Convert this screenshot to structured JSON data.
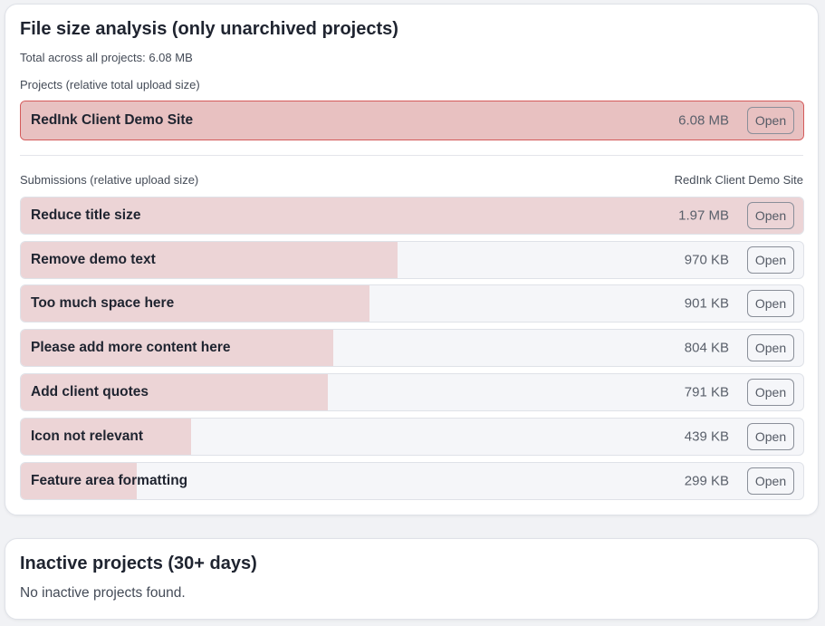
{
  "file_size": {
    "title": "File size analysis (only unarchived projects)",
    "total_text": "Total across all projects: 6.08 MB",
    "projects_heading": "Projects (relative total upload size)",
    "project": {
      "name": "RedInk Client Demo Site",
      "size": "6.08 MB",
      "fraction": 1.0,
      "open_label": "Open"
    },
    "submissions_heading": "Submissions (relative upload size)",
    "selected_project": "RedInk Client Demo Site",
    "submissions": [
      {
        "name": "Reduce title size",
        "size": "1.97 MB",
        "fraction": 1.0,
        "open_label": "Open"
      },
      {
        "name": "Remove demo text",
        "size": "970 KB",
        "fraction": 0.481,
        "open_label": "Open"
      },
      {
        "name": "Too much space here",
        "size": "901 KB",
        "fraction": 0.446,
        "open_label": "Open"
      },
      {
        "name": "Please add more content here",
        "size": "804 KB",
        "fraction": 0.399,
        "open_label": "Open"
      },
      {
        "name": "Add client quotes",
        "size": "791 KB",
        "fraction": 0.392,
        "open_label": "Open"
      },
      {
        "name": "Icon not relevant",
        "size": "439 KB",
        "fraction": 0.218,
        "open_label": "Open"
      },
      {
        "name": "Feature area formatting",
        "size": "299 KB",
        "fraction": 0.148,
        "open_label": "Open"
      }
    ]
  },
  "inactive": {
    "title": "Inactive projects (30+ days)",
    "message": "No inactive projects found."
  },
  "colors": {
    "project_bar": "#e8c1c1",
    "project_border": "#d45a5a",
    "submission_fill": "#ecd4d6",
    "row_background": "#f5f6f9"
  }
}
